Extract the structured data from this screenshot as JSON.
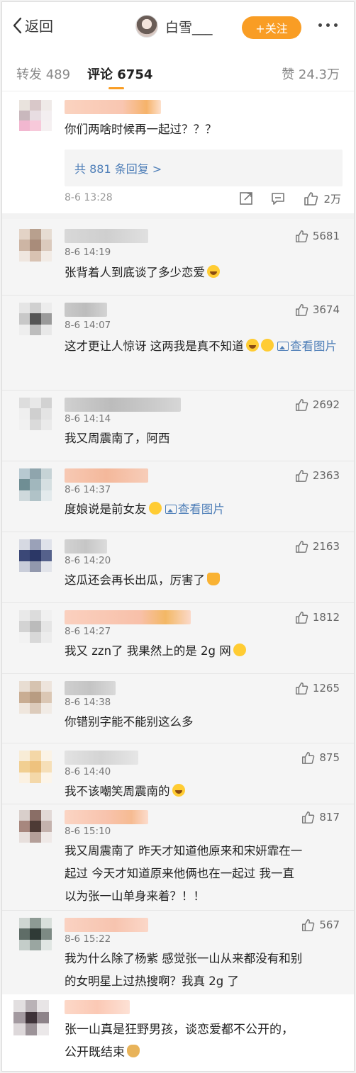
{
  "nav": {
    "back_label": "返回",
    "user_name": "白雪___",
    "follow_label": "+关注"
  },
  "tabs": {
    "repost": "转发 489",
    "comment": "评论 6754",
    "like": "赞 24.3万"
  },
  "top_comment": {
    "text": "你们两啥时候再一起过？？？",
    "replies_link": "共 881 条回复 >",
    "time": "8-6 13:28",
    "likes": "2万"
  },
  "comments": [
    {
      "time": "8-6 14:19",
      "likes": "5681",
      "text": "张背着人到底谈了多少恋爱"
    },
    {
      "time": "8-6 14:07",
      "likes": "3674",
      "text": "这才更让人惊讶 这两我是真不知道",
      "link": "查看图片"
    },
    {
      "time": "8-6 14:14",
      "likes": "2692",
      "text": "我又周震南了，阿西"
    },
    {
      "time": "8-6 14:37",
      "likes": "2363",
      "text": "度娘说是前女友",
      "link": "查看图片"
    },
    {
      "time": "8-6 14:20",
      "likes": "2163",
      "text": "这瓜还会再长出瓜，厉害了"
    },
    {
      "time": "8-6 14:27",
      "likes": "1812",
      "text": "我又 zzn了 我果然上的是 2g 网"
    },
    {
      "time": "8-6 14:38",
      "likes": "1265",
      "text": "你错别字能不能别这么多"
    },
    {
      "time": "8-6 14:40",
      "likes": "875",
      "text": "我不该嘲笑周震南的"
    },
    {
      "time": "8-6 15:10",
      "likes": "817",
      "text_lines": [
        "我又周震南了 昨天才知道他原来和宋妍霏在一",
        "起过 今天才知道原来他俩也在一起过 我一直",
        "以为张一山单身来着？！！"
      ]
    },
    {
      "time": "8-6 15:22",
      "likes": "567",
      "text_lines": [
        "我为什么除了杨紫 感觉张一山从来都没有和别",
        "的女明星上过热搜啊？我真 2g 了"
      ]
    }
  ],
  "last_comment": {
    "text_lines": [
      "张一山真是狂野男孩，谈恋爱都不公开的，",
      "公开既结束"
    ]
  }
}
